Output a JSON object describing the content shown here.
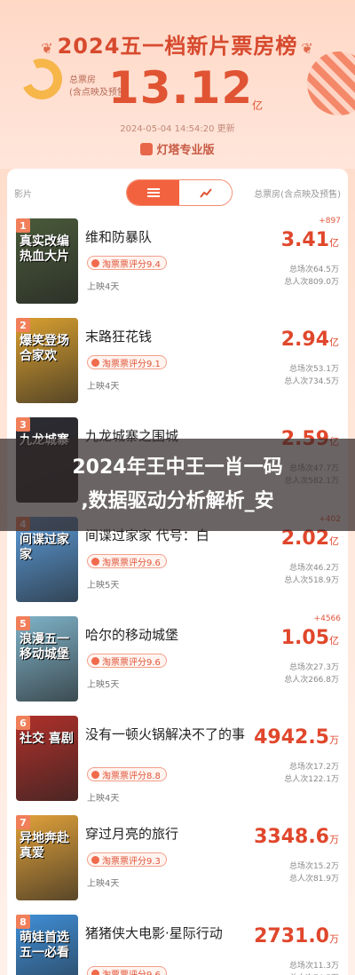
{
  "header": {
    "title": "2024五一档新片票房榜",
    "total_label_line1": "总票房",
    "total_label_line2": "(含点映及预售)",
    "total_value": "13.12",
    "total_unit": "亿",
    "update_time": "2024-05-04 14:54:20 更新",
    "brand": "灯塔专业版"
  },
  "table": {
    "col_film": "影片",
    "col_total": "总票房(含点映及预售)",
    "toggle_list_icon": "list-icon",
    "toggle_chart_icon": "bar-chart-icon"
  },
  "overlay": {
    "line1": "2024年王中王一肖一码",
    "line2": ",数据驱动分析解析_安"
  },
  "movies": [
    {
      "rank": "1",
      "poster_text": "真实改编 热血大片",
      "title": "维和防暴队",
      "score": "淘票票评分9.4",
      "days": "上映4天",
      "delta": "+897",
      "box": "3.41",
      "unit": "亿",
      "shows": "总场次64.5万",
      "people": "总人次809.0万",
      "poster_color": "#4a5a3a"
    },
    {
      "rank": "2",
      "poster_text": "爆笑登场 合家欢",
      "title": "末路狂花钱",
      "score": "淘票票评分9.1",
      "days": "上映4天",
      "delta": "",
      "box": "2.94",
      "unit": "亿",
      "shows": "总场次53.1万",
      "people": "总人次734.5万",
      "poster_color": "#d9a030"
    },
    {
      "rank": "3",
      "poster_text": "九龙城寨",
      "title": "九龙城寨之围城",
      "score": "",
      "days": "",
      "delta": "",
      "box": "2.59",
      "unit": "亿",
      "shows": "总场次47.7万",
      "people": "总人次582.1万",
      "poster_color": "#2c2c33"
    },
    {
      "rank": "4",
      "poster_text": "间谍过家家",
      "title": "间谍过家家 代号：白",
      "score": "淘票票评分9.6",
      "days": "上映5天",
      "delta": "+402",
      "box": "2.02",
      "unit": "亿",
      "shows": "总场次46.2万",
      "people": "总人次518.9万",
      "poster_color": "#5b9bd8"
    },
    {
      "rank": "5",
      "poster_text": "浪漫五一 移动城堡",
      "title": "哈尔的移动城堡",
      "score": "淘票票评分9.6",
      "days": "上映5天",
      "delta": "+4566",
      "box": "1.05",
      "unit": "亿",
      "shows": "总场次27.3万",
      "people": "总人次266.8万",
      "poster_color": "#7fb3c9"
    },
    {
      "rank": "6",
      "poster_text": "社交 喜剧",
      "title": "没有一顿火锅解决不了的事",
      "score": "淘票票评分8.8",
      "days": "上映4天",
      "delta": "",
      "box": "4942.5",
      "unit": "万",
      "shows": "总场次17.2万",
      "people": "总人次122.1万",
      "poster_color": "#b0302a"
    },
    {
      "rank": "7",
      "poster_text": "异地奔赴 真爱",
      "title": "穿过月亮的旅行",
      "score": "淘票票评分9.3",
      "days": "上映4天",
      "delta": "",
      "box": "3348.6",
      "unit": "万",
      "shows": "总场次15.2万",
      "people": "总人次81.9万",
      "poster_color": "#e2a23a"
    },
    {
      "rank": "8",
      "poster_text": "萌娃首选 五一必看",
      "title": "猪猪侠大电影·星际行动",
      "score": "淘票票评分9.6",
      "days": "",
      "delta": "",
      "box": "2731.0",
      "unit": "万",
      "shows": "总场次11.3万",
      "people": "总人次74.5万",
      "poster_color": "#3f8fd8"
    }
  ]
}
